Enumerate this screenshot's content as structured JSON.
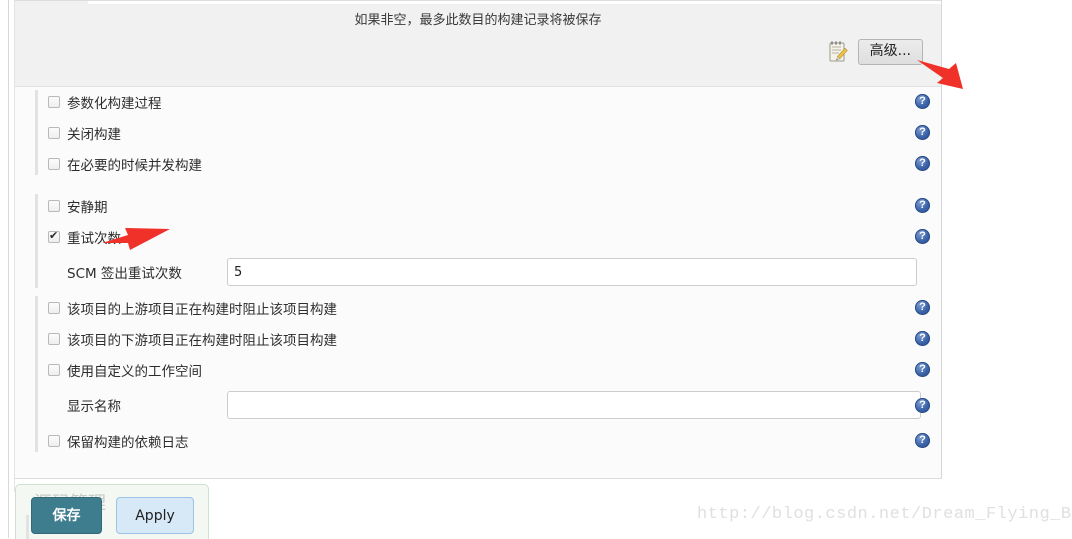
{
  "panel": {
    "description": "如果非空，最多此数目的构建记录将被保存",
    "advanced_button": "高级...",
    "advanced_icon": "notepad-pencil-icon",
    "help_icon": "help-question-icon"
  },
  "options": [
    {
      "label": "参数化构建过程",
      "checked": false,
      "help": true
    },
    {
      "label": "关闭构建",
      "checked": false,
      "help": true
    },
    {
      "label": "在必要的时候并发构建",
      "checked": false,
      "help": true
    },
    {
      "label": "安静期",
      "checked": false,
      "help": true
    },
    {
      "label": "重试次数",
      "checked": true,
      "help": true
    },
    {
      "label": "该项目的上游项目正在构建时阻止该项目构建",
      "checked": false,
      "help": true
    },
    {
      "label": "该项目的下游项目正在构建时阻止该项目构建",
      "checked": false,
      "help": true
    },
    {
      "label": "使用自定义的工作空间",
      "checked": false,
      "help": true
    },
    {
      "label": "保留构建的依赖日志",
      "checked": false,
      "help": true
    }
  ],
  "fields": {
    "scm_retry": {
      "label": "SCM 签出重试次数",
      "value": "5",
      "placeholder": ""
    },
    "display_name": {
      "label": "显示名称",
      "value": "",
      "placeholder": ""
    }
  },
  "bottom": {
    "scm_section_title": "源码管理",
    "save_button": "保存",
    "apply_button": "Apply"
  },
  "watermark": "http://blog.csdn.net/Dream_Flying_BJ",
  "colors": {
    "save_button_bg": "#3d7d8e",
    "apply_button_bg": "#d7e8f7",
    "help_icon_blue": "#3a62a8",
    "arrow_red": "#f0312a",
    "panel_bg": "#fbfbfb",
    "header_bg": "#f1f1f1"
  },
  "annotations": [
    {
      "name": "arrow-pointing-advanced-button",
      "target": "高级..."
    },
    {
      "name": "arrow-pointing-retry-checkbox",
      "target": "重试次数"
    }
  ]
}
